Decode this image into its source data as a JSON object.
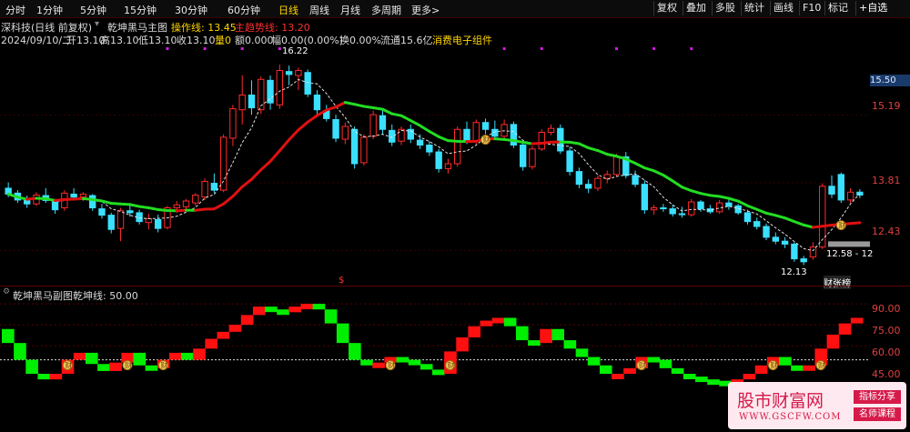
{
  "toolbar": {
    "timeframes": [
      "分时",
      "1分钟",
      "5分钟",
      "15分钟",
      "30分钟",
      "60分钟",
      "日线",
      "周线",
      "月线",
      "多周期",
      "更多>"
    ],
    "active": "日线",
    "buttons": [
      "复权",
      "叠加",
      "多股",
      "统计",
      "画线",
      "F10",
      "标记",
      "+自选"
    ]
  },
  "header": {
    "stock": "深科技(日线 前复权)",
    "indicator": "乾坤黑马主图",
    "op_label": "操作线: 13.45",
    "trend_label": "主趋势线: 13.20"
  },
  "infoline": {
    "date": "2024/09/10/二",
    "open": "开13.10",
    "high": "高13.10",
    "low": "低13.10",
    "close": "收13.10",
    "volume": "量0",
    "amount": "额0.000",
    "change": "幅0.00(0.00%)",
    "turnover": "换0.00%",
    "float": "流通15.6亿",
    "concept": "消费电子组件"
  },
  "main_axis": {
    "price_flag": "15.50",
    "labels": [
      "15.19",
      "13.81",
      "12.43"
    ]
  },
  "main_annotations": {
    "high": "16.22",
    "low": "12.13",
    "range": "12.58 - 12",
    "buy": "财",
    "sell": "$",
    "rank": "财张榜"
  },
  "sub_header": {
    "title": "乾坤黑马副图",
    "value": "乾坤线: 50.00"
  },
  "sub_axis": {
    "labels": [
      "90.00",
      "75.00",
      "60.00",
      "45.00"
    ]
  },
  "watermark": {
    "title": "股市财富网",
    "url": "WWW.GSCFW.COM",
    "tag1": "指标分享",
    "tag2": "名师课程"
  },
  "colors": {
    "up": "#ff2b2b",
    "down": "#3be0ff",
    "trend_up": "#e01010",
    "trend_down": "#22dd22",
    "sub_up": "#ff1010",
    "sub_down": "#00ee00"
  },
  "chart_data": {
    "type": "candlestick",
    "price_range": [
      11.9,
      16.5
    ],
    "candles": [
      {
        "o": 13.7,
        "h": 13.82,
        "l": 13.52,
        "c": 13.58
      },
      {
        "o": 13.6,
        "h": 13.66,
        "l": 13.4,
        "c": 13.46
      },
      {
        "o": 13.45,
        "h": 13.55,
        "l": 13.3,
        "c": 13.38
      },
      {
        "o": 13.38,
        "h": 13.62,
        "l": 13.34,
        "c": 13.56
      },
      {
        "o": 13.55,
        "h": 13.7,
        "l": 13.4,
        "c": 13.45
      },
      {
        "o": 13.42,
        "h": 13.48,
        "l": 13.18,
        "c": 13.26
      },
      {
        "o": 13.3,
        "h": 13.66,
        "l": 13.24,
        "c": 13.6
      },
      {
        "o": 13.58,
        "h": 13.7,
        "l": 13.48,
        "c": 13.52
      },
      {
        "o": 13.52,
        "h": 13.62,
        "l": 13.44,
        "c": 13.58
      },
      {
        "o": 13.55,
        "h": 13.58,
        "l": 13.24,
        "c": 13.3
      },
      {
        "o": 13.28,
        "h": 13.38,
        "l": 13.08,
        "c": 13.15
      },
      {
        "o": 13.15,
        "h": 13.2,
        "l": 12.78,
        "c": 12.86
      },
      {
        "o": 12.88,
        "h": 13.3,
        "l": 12.62,
        "c": 13.24
      },
      {
        "o": 13.24,
        "h": 13.4,
        "l": 13.12,
        "c": 13.2
      },
      {
        "o": 13.2,
        "h": 13.26,
        "l": 12.96,
        "c": 13.02
      },
      {
        "o": 13.0,
        "h": 13.18,
        "l": 12.86,
        "c": 13.08
      },
      {
        "o": 13.06,
        "h": 13.16,
        "l": 12.8,
        "c": 12.88
      },
      {
        "o": 12.9,
        "h": 13.34,
        "l": 12.86,
        "c": 13.3
      },
      {
        "o": 13.3,
        "h": 13.44,
        "l": 13.2,
        "c": 13.36
      },
      {
        "o": 13.32,
        "h": 13.48,
        "l": 13.26,
        "c": 13.44
      },
      {
        "o": 13.4,
        "h": 13.6,
        "l": 13.34,
        "c": 13.56
      },
      {
        "o": 13.52,
        "h": 13.9,
        "l": 13.46,
        "c": 13.84
      },
      {
        "o": 13.8,
        "h": 14.0,
        "l": 13.6,
        "c": 13.66
      },
      {
        "o": 13.66,
        "h": 14.8,
        "l": 13.62,
        "c": 14.74
      },
      {
        "o": 14.72,
        "h": 15.4,
        "l": 14.56,
        "c": 15.32
      },
      {
        "o": 15.3,
        "h": 16.0,
        "l": 15.0,
        "c": 15.6
      },
      {
        "o": 15.6,
        "h": 15.9,
        "l": 15.2,
        "c": 15.34
      },
      {
        "o": 15.3,
        "h": 15.98,
        "l": 15.22,
        "c": 15.92
      },
      {
        "o": 15.9,
        "h": 16.0,
        "l": 15.3,
        "c": 15.44
      },
      {
        "o": 15.4,
        "h": 16.22,
        "l": 15.32,
        "c": 16.1
      },
      {
        "o": 16.08,
        "h": 16.2,
        "l": 15.8,
        "c": 16.02
      },
      {
        "o": 16.0,
        "h": 16.16,
        "l": 15.7,
        "c": 16.1
      },
      {
        "o": 16.06,
        "h": 16.12,
        "l": 15.56,
        "c": 15.62
      },
      {
        "o": 15.6,
        "h": 15.7,
        "l": 15.2,
        "c": 15.3
      },
      {
        "o": 15.28,
        "h": 15.4,
        "l": 15.06,
        "c": 15.12
      },
      {
        "o": 15.1,
        "h": 15.2,
        "l": 14.64,
        "c": 14.72
      },
      {
        "o": 14.7,
        "h": 15.04,
        "l": 14.6,
        "c": 14.96
      },
      {
        "o": 14.9,
        "h": 14.96,
        "l": 14.1,
        "c": 14.2
      },
      {
        "o": 14.22,
        "h": 14.8,
        "l": 14.16,
        "c": 14.74
      },
      {
        "o": 14.76,
        "h": 15.28,
        "l": 14.7,
        "c": 15.2
      },
      {
        "o": 15.18,
        "h": 15.3,
        "l": 14.8,
        "c": 14.9
      },
      {
        "o": 14.88,
        "h": 15.0,
        "l": 14.56,
        "c": 14.64
      },
      {
        "o": 14.66,
        "h": 14.96,
        "l": 14.58,
        "c": 14.9
      },
      {
        "o": 14.9,
        "h": 15.0,
        "l": 14.62,
        "c": 14.7
      },
      {
        "o": 14.68,
        "h": 14.8,
        "l": 14.5,
        "c": 14.58
      },
      {
        "o": 14.58,
        "h": 14.66,
        "l": 14.36,
        "c": 14.44
      },
      {
        "o": 14.44,
        "h": 14.5,
        "l": 14.02,
        "c": 14.1
      },
      {
        "o": 14.1,
        "h": 14.3,
        "l": 14.0,
        "c": 14.2
      },
      {
        "o": 14.2,
        "h": 14.96,
        "l": 14.14,
        "c": 14.9
      },
      {
        "o": 14.9,
        "h": 15.06,
        "l": 14.6,
        "c": 14.66
      },
      {
        "o": 14.66,
        "h": 15.1,
        "l": 14.6,
        "c": 15.04
      },
      {
        "o": 15.04,
        "h": 15.12,
        "l": 14.8,
        "c": 14.9
      },
      {
        "o": 14.9,
        "h": 15.08,
        "l": 14.7,
        "c": 14.76
      },
      {
        "o": 14.76,
        "h": 15.1,
        "l": 14.68,
        "c": 15.0
      },
      {
        "o": 15.0,
        "h": 15.06,
        "l": 14.52,
        "c": 14.58
      },
      {
        "o": 14.58,
        "h": 14.66,
        "l": 14.06,
        "c": 14.14
      },
      {
        "o": 14.14,
        "h": 14.56,
        "l": 14.08,
        "c": 14.5
      },
      {
        "o": 14.5,
        "h": 14.9,
        "l": 14.46,
        "c": 14.84
      },
      {
        "o": 14.84,
        "h": 15.0,
        "l": 14.78,
        "c": 14.92
      },
      {
        "o": 14.92,
        "h": 15.0,
        "l": 14.4,
        "c": 14.46
      },
      {
        "o": 14.46,
        "h": 14.54,
        "l": 13.96,
        "c": 14.04
      },
      {
        "o": 14.04,
        "h": 14.12,
        "l": 13.7,
        "c": 13.78
      },
      {
        "o": 13.78,
        "h": 13.88,
        "l": 13.6,
        "c": 13.7
      },
      {
        "o": 13.7,
        "h": 13.96,
        "l": 13.64,
        "c": 13.9
      },
      {
        "o": 13.9,
        "h": 14.06,
        "l": 13.8,
        "c": 13.98
      },
      {
        "o": 13.98,
        "h": 14.4,
        "l": 13.94,
        "c": 14.34
      },
      {
        "o": 14.34,
        "h": 14.44,
        "l": 13.9,
        "c": 13.96
      },
      {
        "o": 13.96,
        "h": 14.06,
        "l": 13.72,
        "c": 13.78
      },
      {
        "o": 13.78,
        "h": 13.86,
        "l": 13.18,
        "c": 13.26
      },
      {
        "o": 13.26,
        "h": 13.36,
        "l": 13.16,
        "c": 13.3
      },
      {
        "o": 13.3,
        "h": 13.38,
        "l": 13.22,
        "c": 13.28
      },
      {
        "o": 13.28,
        "h": 13.36,
        "l": 13.12,
        "c": 13.18
      },
      {
        "o": 13.18,
        "h": 13.32,
        "l": 13.1,
        "c": 13.16
      },
      {
        "o": 13.16,
        "h": 13.48,
        "l": 13.12,
        "c": 13.42
      },
      {
        "o": 13.42,
        "h": 13.46,
        "l": 13.22,
        "c": 13.28
      },
      {
        "o": 13.28,
        "h": 13.36,
        "l": 13.18,
        "c": 13.22
      },
      {
        "o": 13.22,
        "h": 13.46,
        "l": 13.18,
        "c": 13.4
      },
      {
        "o": 13.4,
        "h": 13.52,
        "l": 13.26,
        "c": 13.34
      },
      {
        "o": 13.34,
        "h": 13.38,
        "l": 13.16,
        "c": 13.2
      },
      {
        "o": 13.2,
        "h": 13.26,
        "l": 12.96,
        "c": 13.02
      },
      {
        "o": 13.02,
        "h": 13.1,
        "l": 12.86,
        "c": 12.92
      },
      {
        "o": 12.92,
        "h": 12.98,
        "l": 12.64,
        "c": 12.7
      },
      {
        "o": 12.7,
        "h": 12.8,
        "l": 12.56,
        "c": 12.62
      },
      {
        "o": 12.62,
        "h": 12.7,
        "l": 12.48,
        "c": 12.56
      },
      {
        "o": 12.56,
        "h": 12.6,
        "l": 12.2,
        "c": 12.26
      },
      {
        "o": 12.26,
        "h": 12.32,
        "l": 12.13,
        "c": 12.2
      },
      {
        "o": 12.3,
        "h": 12.6,
        "l": 12.24,
        "c": 12.5
      },
      {
        "o": 12.5,
        "h": 13.8,
        "l": 12.46,
        "c": 13.74
      },
      {
        "o": 13.74,
        "h": 13.96,
        "l": 13.5,
        "c": 13.58
      },
      {
        "o": 13.98,
        "h": 14.02,
        "l": 13.4,
        "c": 13.46
      },
      {
        "o": 13.46,
        "h": 13.7,
        "l": 13.4,
        "c": 13.62
      },
      {
        "o": 13.62,
        "h": 13.68,
        "l": 13.5,
        "c": 13.56
      }
    ],
    "sub_range": [
      40,
      92
    ],
    "sub_bars": [
      {
        "o": 72,
        "c": 62
      },
      {
        "o": 62,
        "c": 50
      },
      {
        "o": 50,
        "c": 40
      },
      {
        "o": 40,
        "c": 36
      },
      {
        "o": 36,
        "c": 40
      },
      {
        "o": 40,
        "c": 50
      },
      {
        "o": 50,
        "c": 55
      },
      {
        "o": 55,
        "c": 47
      },
      {
        "o": 47,
        "c": 42
      },
      {
        "o": 42,
        "c": 48
      },
      {
        "o": 48,
        "c": 55
      },
      {
        "o": 55,
        "c": 46
      },
      {
        "o": 46,
        "c": 44
      },
      {
        "o": 44,
        "c": 50
      },
      {
        "o": 50,
        "c": 55
      },
      {
        "o": 55,
        "c": 50
      },
      {
        "o": 50,
        "c": 58
      },
      {
        "o": 58,
        "c": 65
      },
      {
        "o": 65,
        "c": 70
      },
      {
        "o": 70,
        "c": 75
      },
      {
        "o": 75,
        "c": 82
      },
      {
        "o": 82,
        "c": 88
      },
      {
        "o": 88,
        "c": 86
      },
      {
        "o": 86,
        "c": 84
      },
      {
        "o": 84,
        "c": 88
      },
      {
        "o": 88,
        "c": 90
      },
      {
        "o": 90,
        "c": 86
      },
      {
        "o": 86,
        "c": 76
      },
      {
        "o": 76,
        "c": 62
      },
      {
        "o": 62,
        "c": 50
      },
      {
        "o": 50,
        "c": 46
      },
      {
        "o": 46,
        "c": 48
      },
      {
        "o": 48,
        "c": 52
      },
      {
        "o": 52,
        "c": 50
      },
      {
        "o": 50,
        "c": 47
      },
      {
        "o": 47,
        "c": 43
      },
      {
        "o": 43,
        "c": 40
      },
      {
        "o": 40,
        "c": 56
      },
      {
        "o": 56,
        "c": 66
      },
      {
        "o": 66,
        "c": 74
      },
      {
        "o": 74,
        "c": 78
      },
      {
        "o": 78,
        "c": 80
      },
      {
        "o": 80,
        "c": 74
      },
      {
        "o": 74,
        "c": 64
      },
      {
        "o": 64,
        "c": 62
      },
      {
        "o": 62,
        "c": 72
      },
      {
        "o": 72,
        "c": 64
      },
      {
        "o": 64,
        "c": 58
      },
      {
        "o": 58,
        "c": 52
      },
      {
        "o": 52,
        "c": 46
      },
      {
        "o": 46,
        "c": 40
      },
      {
        "o": 40,
        "c": 40
      },
      {
        "o": 40,
        "c": 44
      },
      {
        "o": 44,
        "c": 52
      },
      {
        "o": 52,
        "c": 50
      },
      {
        "o": 50,
        "c": 44
      },
      {
        "o": 44,
        "c": 40
      },
      {
        "o": 40,
        "c": 38
      },
      {
        "o": 38,
        "c": 36
      },
      {
        "o": 36,
        "c": 35
      },
      {
        "o": 35,
        "c": 34
      },
      {
        "o": 34,
        "c": 36
      },
      {
        "o": 36,
        "c": 40
      },
      {
        "o": 40,
        "c": 46
      },
      {
        "o": 46,
        "c": 52
      },
      {
        "o": 52,
        "c": 46
      },
      {
        "o": 46,
        "c": 44
      },
      {
        "o": 44,
        "c": 46
      },
      {
        "o": 46,
        "c": 58
      },
      {
        "o": 58,
        "c": 68
      },
      {
        "o": 68,
        "c": 76
      },
      {
        "o": 76,
        "c": 80
      }
    ]
  }
}
